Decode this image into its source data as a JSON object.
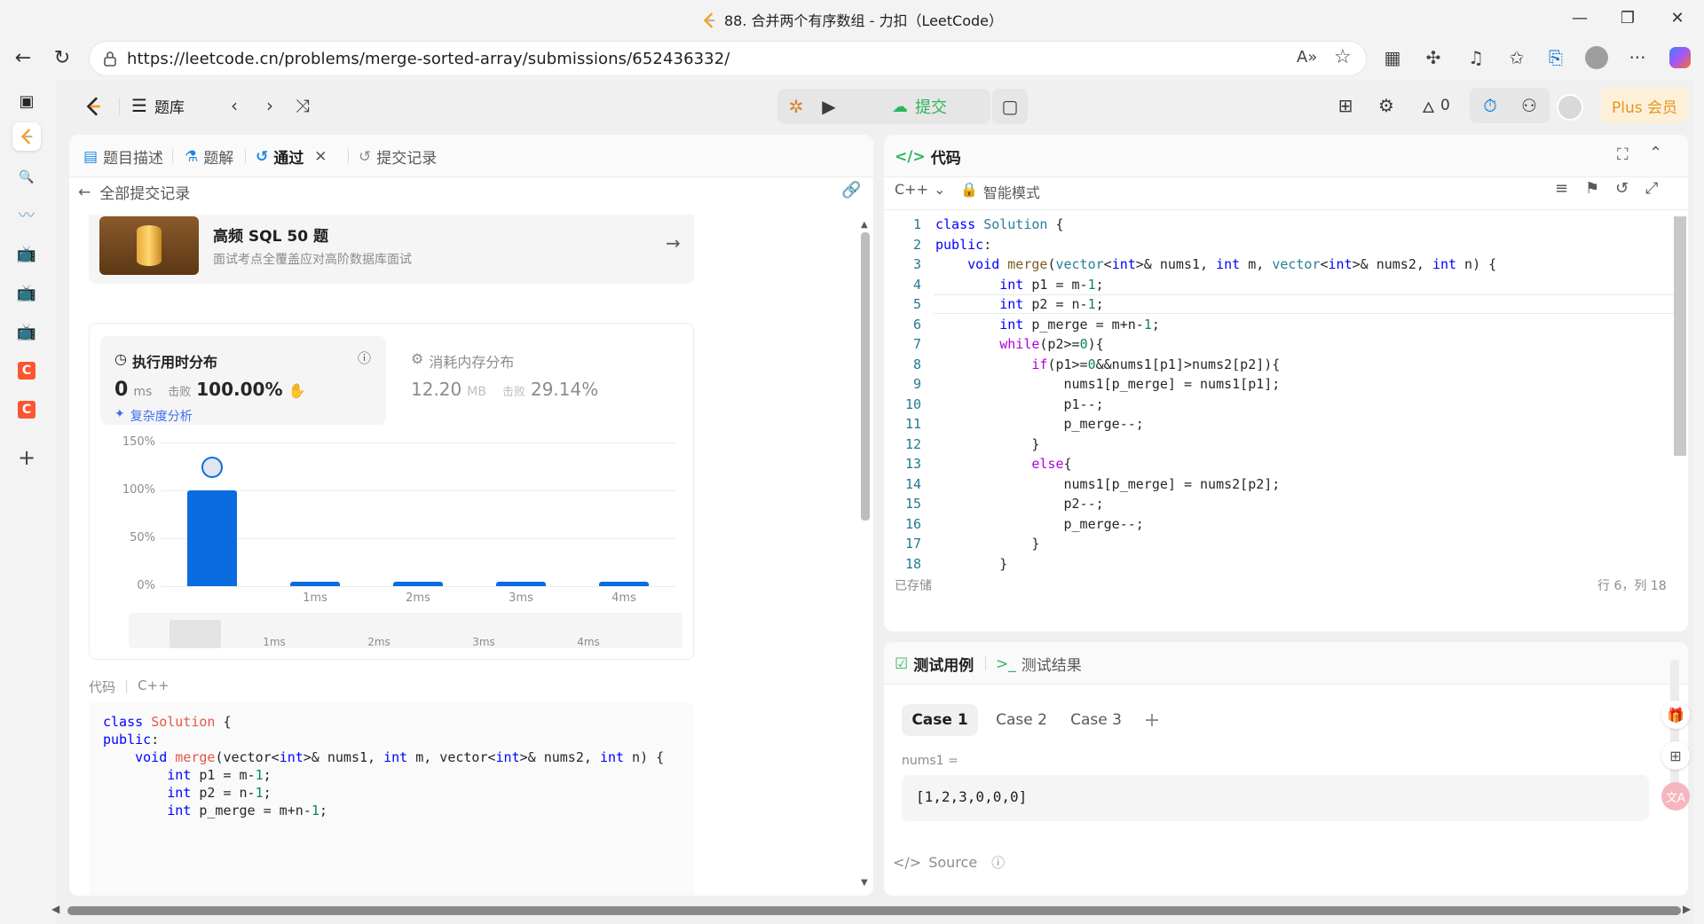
{
  "window": {
    "title": "88. 合并两个有序数组 - 力扣（LeetCode）"
  },
  "browser": {
    "url": "https://leetcode.cn/problems/merge-sorted-array/submissions/652436332/"
  },
  "header": {
    "problem_list": "题库",
    "submit": "提交",
    "streak": "0",
    "plus": "Plus 会员"
  },
  "left": {
    "tabs": [
      "题目描述",
      "题解",
      "通过",
      "提交记录"
    ],
    "back_label": "全部提交记录",
    "promo": {
      "title": "高频 SQL 50 题",
      "subtitle": "面试考点全覆盖应对高阶数据库面试"
    },
    "runtime": {
      "label": "执行用时分布",
      "value": "0",
      "unit": "ms",
      "beat_label": "击败",
      "beat": "100.00%",
      "analysis": "复杂度分析"
    },
    "memory": {
      "label": "消耗内存分布",
      "value": "12.20",
      "unit": "MB",
      "beat_label": "击败",
      "beat": "29.14%"
    },
    "code_label": "代码",
    "code_lang": "C++"
  },
  "chart_data": {
    "type": "bar",
    "categories": [
      "0ms",
      "1ms",
      "2ms",
      "3ms",
      "4ms"
    ],
    "x_tick_labels": [
      "",
      "1ms",
      "2ms",
      "3ms",
      "4ms"
    ],
    "values": [
      100,
      2,
      2,
      2,
      2
    ],
    "y_tick_labels": [
      "150%",
      "100%",
      "50%",
      "0%"
    ],
    "ylim": [
      0,
      150
    ],
    "grid": true,
    "mini_labels": [
      "1ms",
      "2ms",
      "3ms",
      "4ms"
    ]
  },
  "right": {
    "title": "代码",
    "lang": "C++",
    "mode": "智能模式",
    "status": "已存储",
    "cursor": "行 6，列 18",
    "cases_tab": "测试用例",
    "results_tab": "测试结果",
    "cases": [
      "Case 1",
      "Case 2",
      "Case 3"
    ],
    "var_label": "nums1 =",
    "var_value": "[1,2,3,0,0,0]",
    "source": "Source"
  }
}
